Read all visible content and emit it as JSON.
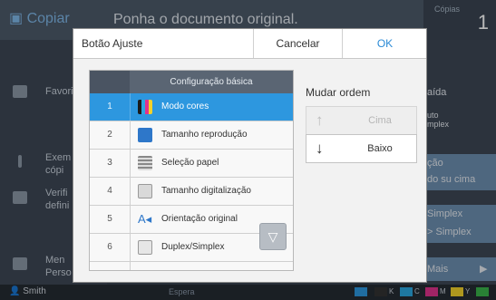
{
  "background": {
    "app_title": "Copiar",
    "message": "Ponha o documento original.",
    "copies_label": "Cópias",
    "copies_value": "1",
    "left_menu": [
      "Favori",
      "Exem\ncópi",
      "Verifi\ndefini",
      "Men\nPerso"
    ],
    "right_menu": [
      "aída",
      "uto\nmplex",
      "ção",
      "do su cima",
      "Simplex",
      "> Simplex",
      "Mais"
    ],
    "user": "Smith",
    "status": "Espera",
    "toner": [
      {
        "label": "K",
        "color": "#333333"
      },
      {
        "label": "C",
        "color": "#2aa7e0"
      },
      {
        "label": "M",
        "color": "#e0338c"
      },
      {
        "label": "Y",
        "color": "#f2d22a"
      },
      {
        "label": "G",
        "color": "#3ab34a"
      }
    ]
  },
  "dialog": {
    "title": "Botão Ajuste",
    "cancel_label": "Cancelar",
    "ok_label": "OK",
    "list_header": "Configuração básica",
    "items": [
      {
        "num": "1",
        "label": "Modo cores",
        "icon": "color-mode-icon",
        "icon_color": "#4a7fd4"
      },
      {
        "num": "2",
        "label": "Tamanho reprodução",
        "icon": "reproduction-size-icon",
        "icon_color": "#2e77c9"
      },
      {
        "num": "3",
        "label": "Seleção papel",
        "icon": "paper-tray-icon",
        "icon_color": "#888888"
      },
      {
        "num": "4",
        "label": "Tamanho digitalização",
        "icon": "scan-size-icon",
        "icon_color": "#999999"
      },
      {
        "num": "5",
        "label": "Orientação original",
        "icon": "orientation-icon",
        "icon_color": "#2e77c9"
      },
      {
        "num": "6",
        "label": "Duplex/Simplex",
        "icon": "duplex-icon",
        "icon_color": "#999999"
      }
    ],
    "selected_index": 0,
    "order_title": "Mudar ordem",
    "up_label": "Cima",
    "down_label": "Baixo"
  }
}
